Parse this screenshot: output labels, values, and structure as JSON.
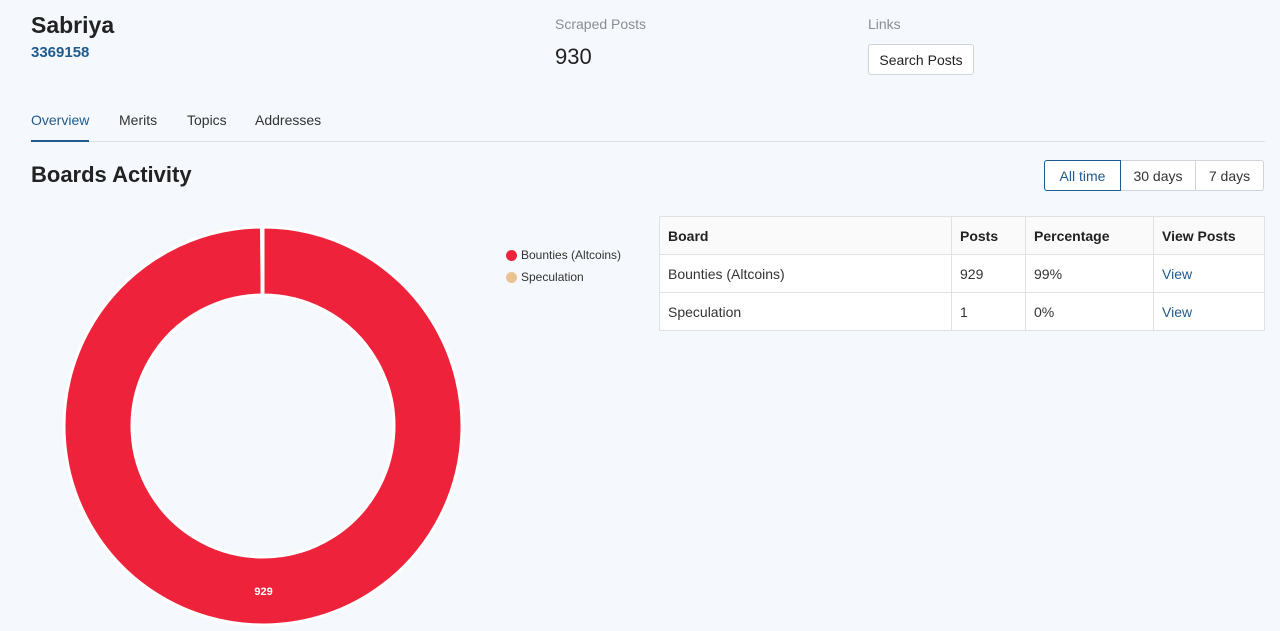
{
  "user": {
    "name": "Sabriya",
    "id": "3369158"
  },
  "stats": {
    "scraped_label": "Scraped Posts",
    "scraped_value": "930",
    "links_label": "Links",
    "search_button": "Search Posts"
  },
  "tabs": [
    {
      "label": "Overview"
    },
    {
      "label": "Merits"
    },
    {
      "label": "Topics"
    },
    {
      "label": "Addresses"
    }
  ],
  "section": {
    "title": "Boards Activity"
  },
  "ranges": [
    {
      "label": "All time"
    },
    {
      "label": "30 days"
    },
    {
      "label": "7 days"
    }
  ],
  "table": {
    "headers": [
      "Board",
      "Posts",
      "Percentage",
      "View Posts"
    ],
    "rows": [
      {
        "board": "Bounties (Altcoins)",
        "posts": "929",
        "percentage": "99%",
        "view": "View"
      },
      {
        "board": "Speculation",
        "posts": "1",
        "percentage": "0%",
        "view": "View"
      }
    ]
  },
  "chart_data": {
    "type": "pie",
    "categories": [
      "Bounties (Altcoins)",
      "Speculation"
    ],
    "values": [
      929,
      1
    ],
    "colors": [
      "#ee223b",
      "#ebc291"
    ],
    "data_labels": [
      "929",
      ""
    ]
  }
}
